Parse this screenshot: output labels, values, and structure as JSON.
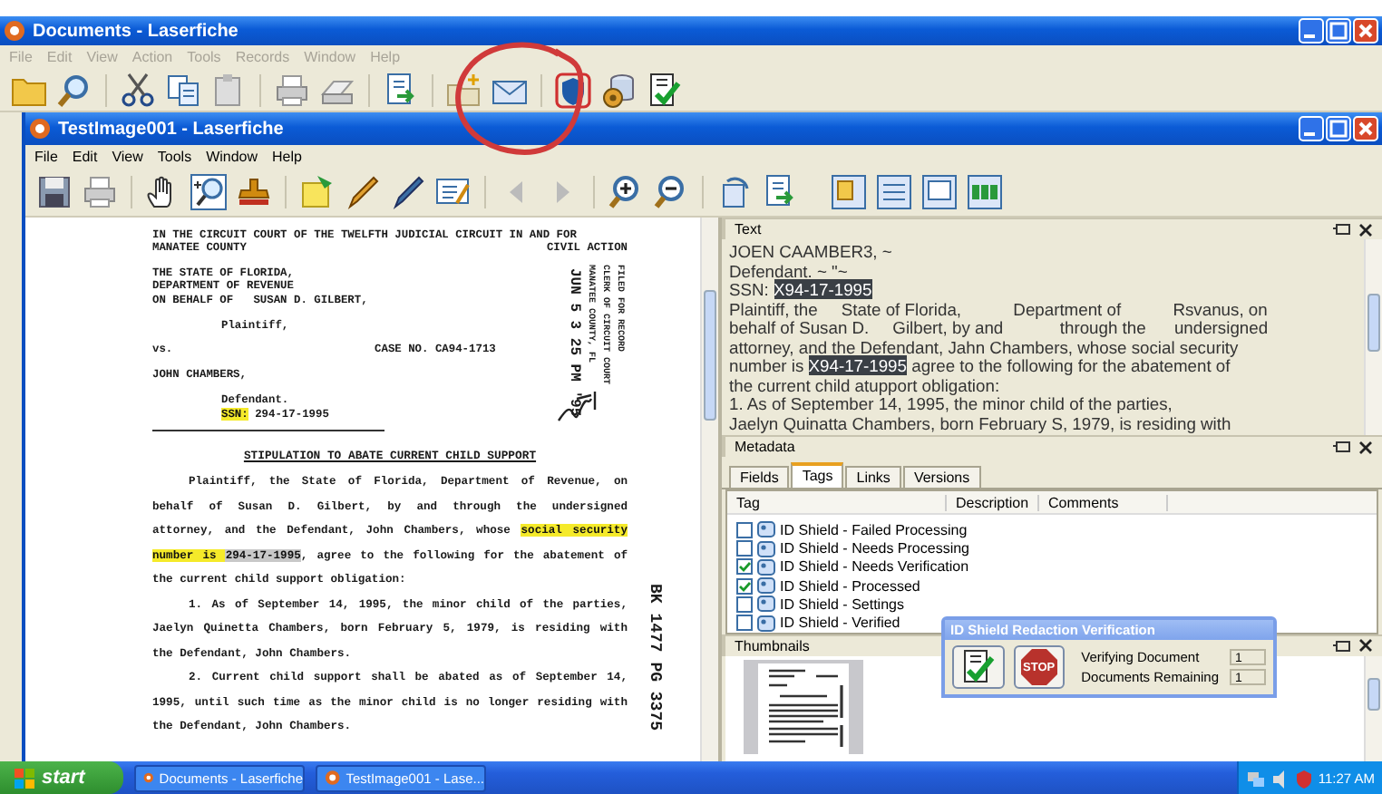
{
  "window": {
    "title": "Documents - Laserfiche"
  },
  "menu": [
    {
      "label": "File",
      "disabled": true
    },
    {
      "label": "Edit",
      "disabled": true
    },
    {
      "label": "View",
      "disabled": true
    },
    {
      "label": "Action",
      "disabled": true
    },
    {
      "label": "Tools",
      "disabled": true
    },
    {
      "label": "Records",
      "disabled": true
    },
    {
      "label": "Window",
      "disabled": true
    },
    {
      "label": "Help",
      "disabled": true
    }
  ],
  "document_window": {
    "title": "TestImage001 - Laserfiche",
    "menu": [
      {
        "label": "File",
        "disabled": false
      },
      {
        "label": "Edit",
        "disabled": false
      },
      {
        "label": "View",
        "disabled": false
      },
      {
        "label": "Tools",
        "disabled": false
      },
      {
        "label": "Window",
        "disabled": false
      },
      {
        "label": "Help",
        "disabled": false
      }
    ]
  },
  "document": {
    "blocks": [
      {
        "kind": "compact",
        "lines": [
          {
            "segments": [
              {
                "text": "IN THE CIRCUIT COURT OF THE TWELFTH JUDICIAL CIRCUIT IN AND FOR"
              }
            ]
          },
          {
            "kind": "split",
            "segments": [
              {
                "text": "MANATEE COUNTY"
              },
              {
                "text": "CIVIL ACTION"
              }
            ]
          }
        ]
      },
      {
        "kind": "compact",
        "lines": [
          {
            "segments": [
              {
                "text": "THE STATE OF FLORIDA,"
              }
            ]
          },
          {
            "segments": [
              {
                "text": "DEPARTMENT OF REVENUE"
              }
            ]
          },
          {
            "segments": [
              {
                "text": "ON BEHALF OF   SUSAN D. GILBERT,"
              }
            ]
          }
        ]
      },
      {
        "kind": "indented",
        "lines": [
          {
            "segments": [
              {
                "text": "Plaintiff,"
              }
            ]
          }
        ]
      },
      {
        "kind": "compact",
        "lines": [
          {
            "segments": [
              {
                "text": "vs.                              CASE NO. CA94-1713"
              }
            ]
          }
        ]
      },
      {
        "kind": "compact",
        "lines": [
          {
            "segments": [
              {
                "text": "JOHN CHAMBERS,"
              }
            ]
          }
        ]
      },
      {
        "kind": "indented",
        "lines": [
          {
            "segments": [
              {
                "text": "Defendant."
              }
            ]
          },
          {
            "segments": [
              {
                "text": "SSN:",
                "color": "#f5ea2a"
              },
              {
                "text": " 294-17-1995"
              }
            ]
          }
        ]
      },
      {
        "kind": "rule"
      },
      {
        "kind": "heading",
        "lines": [
          {
            "segments": [
              {
                "text": "STIPULATION TO ABATE CURRENT CHILD SUPPORT"
              }
            ]
          }
        ]
      },
      {
        "kind": "paragraph",
        "lines": [
          {
            "segments": [
              {
                "text": "Plaintiff, the State of Florida, Department of Revenue, on"
              }
            ]
          },
          {
            "segments": [
              {
                "text": "behalf of Susan D. Gilbert, by and through the undersigned"
              }
            ]
          },
          {
            "segments": [
              {
                "text": "attorney, and the Defendant, John Chambers, whose "
              },
              {
                "text": "social security",
                "color": "#f5ea2a"
              }
            ]
          },
          {
            "segments": [
              {
                "text": "number is ",
                "color": "#f5ea2a"
              },
              {
                "text": "294-17-1995",
                "color": "#c8c8c8"
              },
              {
                "text": ", agree to the following for the abatement of"
              }
            ]
          },
          {
            "segments": [
              {
                "text": "the current child support obligation:"
              }
            ]
          }
        ]
      },
      {
        "kind": "paragraph",
        "lines": [
          {
            "segments": [
              {
                "text": "1. As of September 14, 1995, the minor child of the parties,"
              }
            ]
          },
          {
            "segments": [
              {
                "text": "Jaelyn Quinetta Chambers, born February 5, 1979, is residing with"
              }
            ]
          },
          {
            "segments": [
              {
                "text": "the Defendant, John Chambers."
              }
            ]
          }
        ]
      },
      {
        "kind": "paragraph",
        "lines": [
          {
            "segments": [
              {
                "text": "2. Current child support shall be abated as of September 14,"
              }
            ]
          },
          {
            "segments": [
              {
                "text": "1995, until such time as the minor child is no longer residing with"
              }
            ]
          },
          {
            "segments": [
              {
                "text": "the Defendant, John Chambers."
              }
            ]
          }
        ]
      }
    ],
    "stamps": [
      {
        "kind": "date",
        "text": "JUN 5 3 25 PM '95"
      },
      {
        "kind": "filed",
        "text": "FILED FOR RECORD"
      },
      {
        "kind": "clerk",
        "text": "CLERK OF CIRCUIT COURT"
      },
      {
        "kind": "county",
        "text": "MANATEE COUNTY, FL"
      },
      {
        "kind": "book",
        "text": "BK 1477 PG 3375"
      }
    ]
  },
  "text_panel": {
    "title": "Text",
    "lines": [
      {
        "segments": [
          {
            "text": "JOEN CAAMBER3, ~"
          }
        ]
      },
      {
        "segments": [
          {
            "text": "Defendant. ~ \"~"
          }
        ]
      },
      {
        "segments": [
          {
            "text": "SSN: "
          },
          {
            "text": "X94-17-1995",
            "color": "#3a3f45"
          }
        ]
      },
      {
        "segments": [
          {
            "text": "Plaintiff, the     State of Florida,           Department of           Rsvanus, on"
          }
        ]
      },
      {
        "segments": [
          {
            "text": "behalf of Susan D.     Gilbert, by and            through the      undersigned"
          }
        ]
      },
      {
        "segments": [
          {
            "text": "attorney, and the Defendant, Jahn Chambers, whose social security"
          }
        ]
      },
      {
        "segments": [
          {
            "text": "number is "
          },
          {
            "text": "X94-17-1995",
            "color": "#3a3f45"
          },
          {
            "text": " agree to the following for the abatement of"
          }
        ]
      },
      {
        "segments": [
          {
            "text": "the current child atupport obligation:"
          }
        ]
      },
      {
        "segments": [
          {
            "text": "1. As of September 14, 1995, the minor child of the parties,"
          }
        ]
      },
      {
        "segments": [
          {
            "text": "Jaelyn Quinatta Chambers, born February S, 1979, is residing with"
          }
        ]
      }
    ]
  },
  "metadata": {
    "title": "Metadata",
    "tabs": [
      {
        "label": "Fields",
        "selected": false
      },
      {
        "label": "Tags",
        "selected": true
      },
      {
        "label": "Links",
        "selected": false
      },
      {
        "label": "Versions",
        "selected": false
      }
    ],
    "columns": [
      "Tag",
      "Description",
      "Comments"
    ],
    "tags": [
      {
        "label": "ID Shield - Failed Processing",
        "checked": false
      },
      {
        "label": "ID Shield - Needs Processing",
        "checked": false
      },
      {
        "label": "ID Shield - Needs Verification",
        "checked": true
      },
      {
        "label": "ID Shield - Processed",
        "checked": true
      },
      {
        "label": "ID Shield - Settings",
        "checked": false
      },
      {
        "label": "ID Shield - Verified",
        "checked": false
      }
    ]
  },
  "thumbnails": {
    "title": "Thumbnails"
  },
  "dialog": {
    "title": "ID Shield Redaction Verification",
    "stop_label": "STOP",
    "fields": [
      {
        "label": "Verifying Document",
        "value": "1"
      },
      {
        "label": "Documents Remaining",
        "value": "1"
      }
    ]
  },
  "taskbar": {
    "start": "start",
    "tasks": [
      {
        "label": "Documents - Laserfiche"
      },
      {
        "label": "TestImage001 - Lase..."
      }
    ],
    "clock": "11:27 AM"
  }
}
